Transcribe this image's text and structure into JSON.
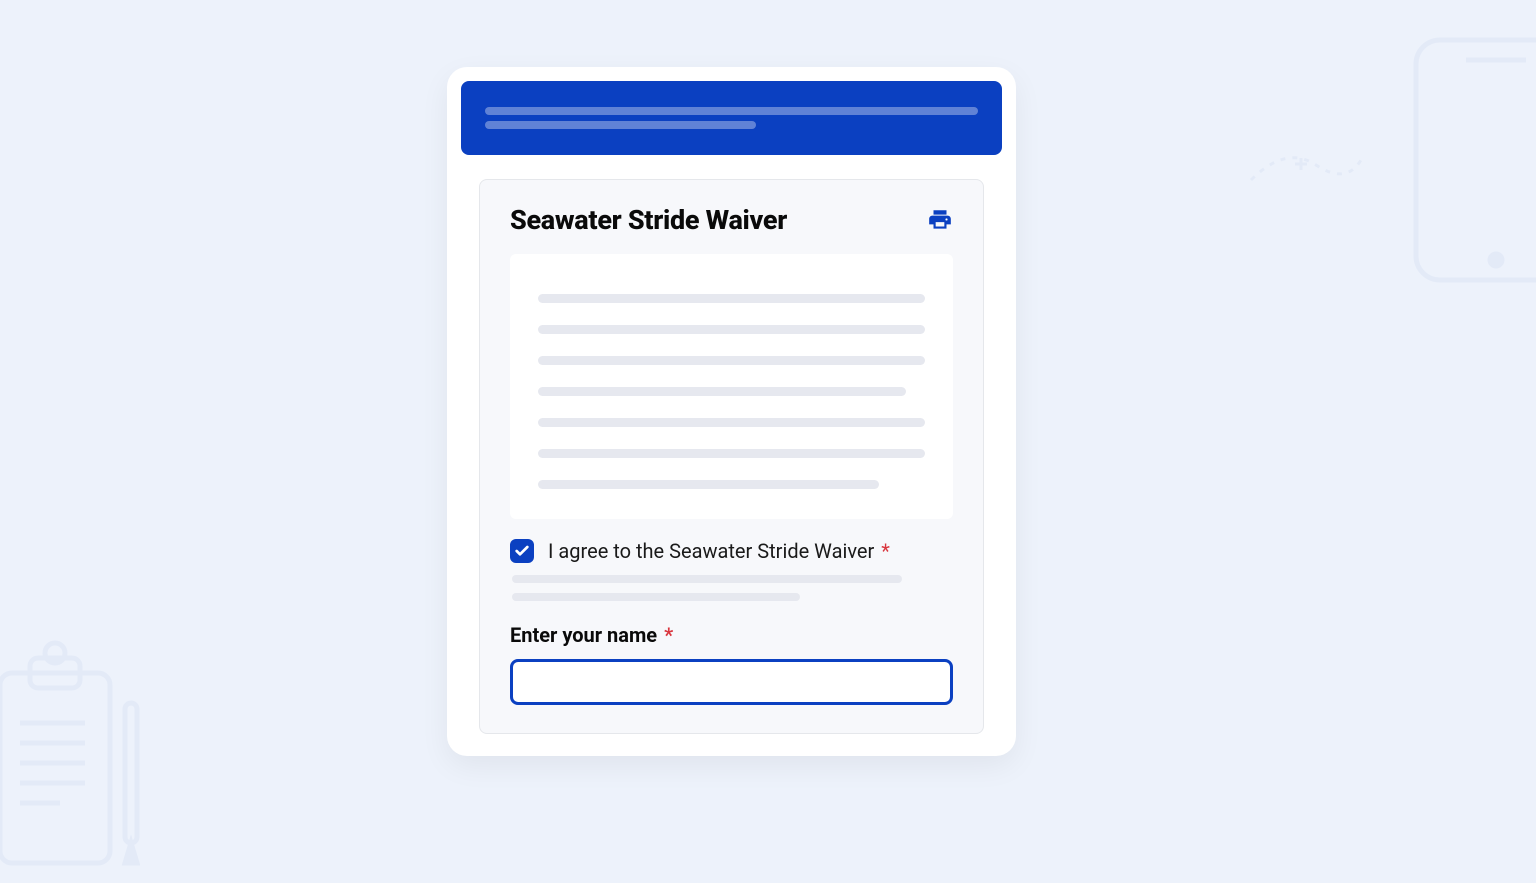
{
  "form": {
    "title": "Seawater Stride Waiver",
    "agree_label": "I agree to the Seawater Stride Waiver",
    "required_mark": "*",
    "name_label": "Enter your name",
    "name_value": "",
    "name_placeholder": "",
    "checkbox_checked": true
  },
  "icons": {
    "print": "print-icon",
    "check": "check-icon"
  },
  "colors": {
    "primary": "#0b40c1",
    "bg": "#edf2fb",
    "required": "#d9363e"
  }
}
